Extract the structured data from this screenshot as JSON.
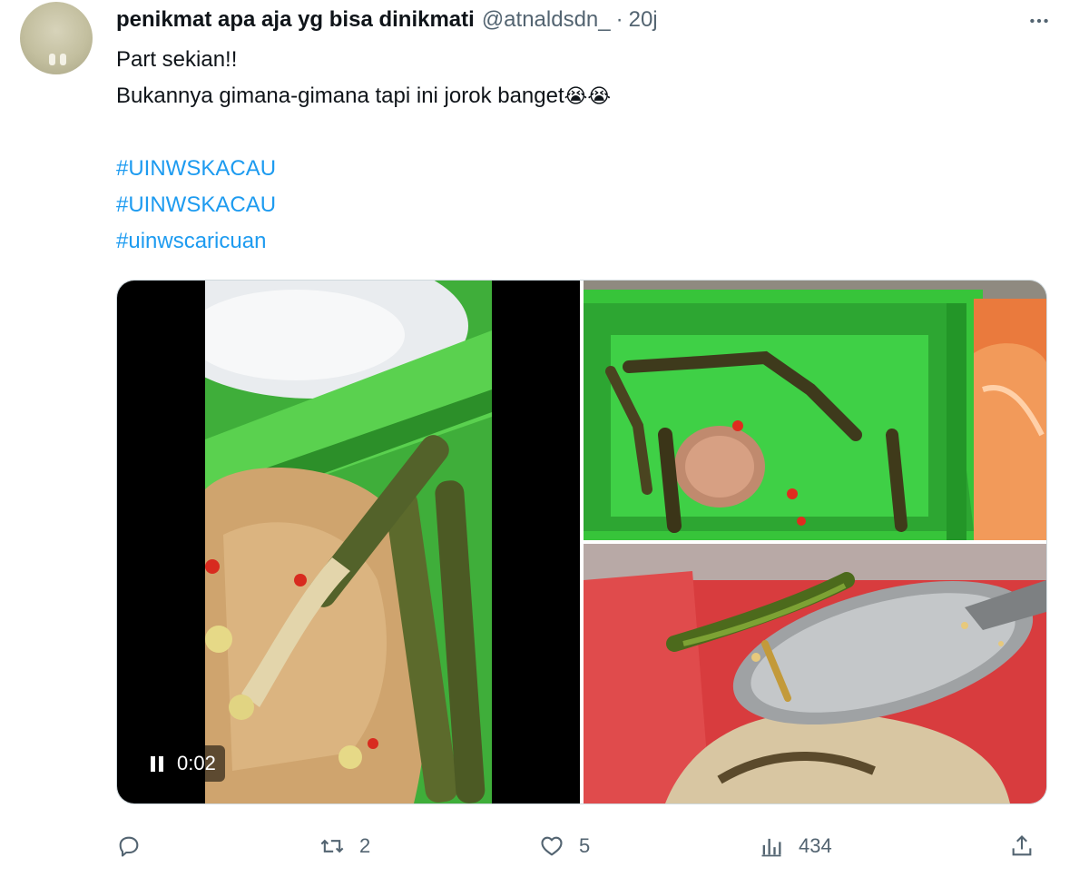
{
  "post": {
    "author": {
      "display_name": "penikmat apa aja yg bisa dinikmati",
      "handle": "@atnaldsdn_",
      "separator": "·",
      "time": "20j"
    },
    "text_lines": [
      "Part sekian!!",
      "Bukannya gimana-gimana tapi ini jorok banget"
    ],
    "emoji": "😭😭",
    "hashtags": [
      "#UINWSKACAU",
      "#UINWSKACAU",
      "#uinwscaricuan"
    ],
    "media": {
      "video_time": "0:02"
    },
    "actions": {
      "replies": "",
      "retweets": "2",
      "likes": "5",
      "views": "434"
    },
    "icons": {
      "more": "more-icon",
      "reply": "reply-icon",
      "retweet": "retweet-icon",
      "like": "heart-icon",
      "views": "views-icon",
      "share": "share-icon"
    },
    "colors": {
      "text": "#0f1419",
      "muted": "#536471",
      "link": "#1d9bf0"
    }
  }
}
